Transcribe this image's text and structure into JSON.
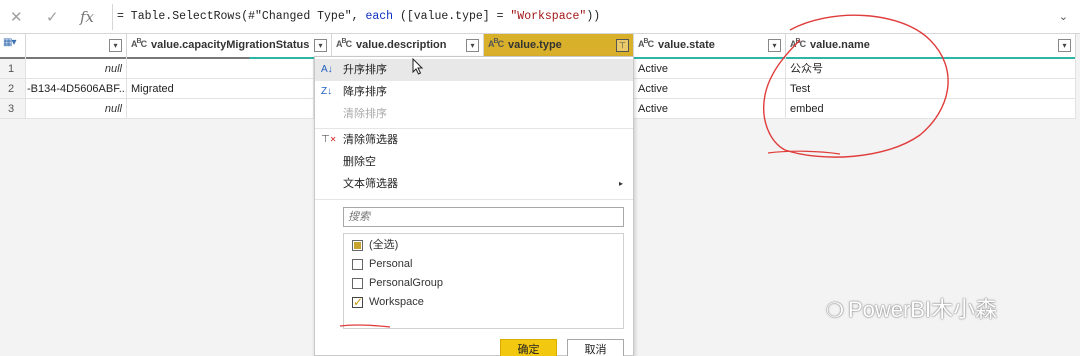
{
  "formula_bar": {
    "formula_prefix": "= Table.SelectRows(#\"Changed Type\", ",
    "formula_keyword": "each",
    "formula_middle": " ([value.type] = ",
    "formula_string": "\"Workspace\"",
    "formula_suffix": "))",
    "fx_label": "fx"
  },
  "columns": [
    {
      "type": "",
      "name": ""
    },
    {
      "type": "ABC",
      "name": "value.capacityMigrationStatus"
    },
    {
      "type": "ABC",
      "name": "value.description"
    },
    {
      "type": "ABC",
      "name": "value.type"
    },
    {
      "type": "ABC",
      "name": "value.state"
    },
    {
      "type": "ABC",
      "name": "value.name"
    }
  ],
  "rows": [
    {
      "num": "1",
      "c0": "null",
      "c1": "",
      "state": "Active",
      "name": "公众号"
    },
    {
      "num": "2",
      "c0": "-B134-4D5606ABF...",
      "c1": "Migrated",
      "state": "Active",
      "name": "Test"
    },
    {
      "num": "3",
      "c0": "null",
      "c1": "",
      "state": "Active",
      "name": "embed"
    }
  ],
  "menu": {
    "sort_asc": "升序排序",
    "sort_desc": "降序排序",
    "clear_sort": "清除排序",
    "clear_filter": "清除筛选器",
    "remove_empty": "删除空",
    "text_filters": "文本筛选器",
    "search_placeholder": "搜索",
    "options": [
      "(全选)",
      "Personal",
      "PersonalGroup",
      "Workspace"
    ],
    "ok": "确定",
    "cancel": "取消"
  },
  "watermark": "PowerBI木小森",
  "colors": {
    "accent": "#f2c811",
    "selected_header": "#d9b02a",
    "quality_bar": "#2fb5a6",
    "annotation": "#e03c3c"
  }
}
